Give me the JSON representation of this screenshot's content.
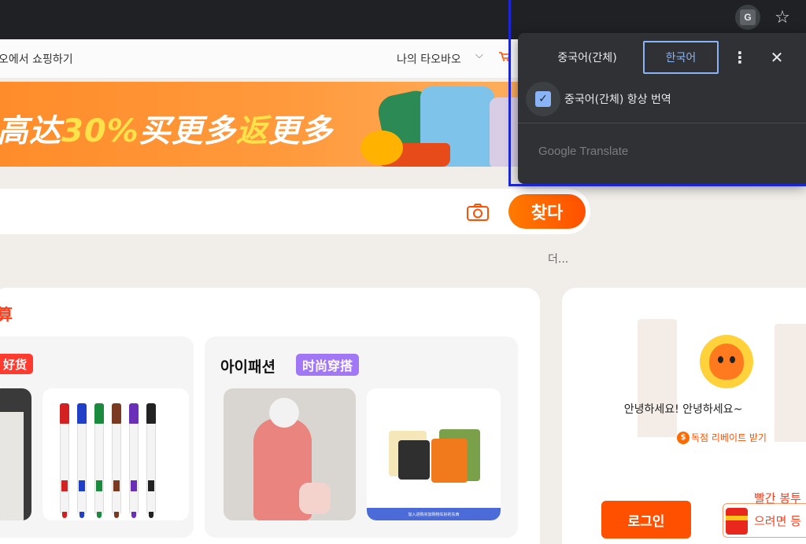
{
  "browser": {
    "translate_icon_text": "G",
    "star_icon_glyph": "☆"
  },
  "nav": {
    "title": "오에서 쇼핑하기",
    "my_taobao": "나의 타오바오",
    "chevron": "⌵"
  },
  "banner": {
    "text_prefix": "高达",
    "text_highlight1": "30%",
    "text_mid": "买更多",
    "text_highlight2": "返",
    "text_suffix": "更多"
  },
  "search": {
    "button_label": "찾다",
    "more_link": "더..."
  },
  "main": {
    "card_title": "算",
    "subcards": [
      {
        "tag": "好货"
      },
      {
        "title": "아이패션",
        "tag": "时尚穿搭"
      }
    ],
    "bag_strip_text": "加入进购买加购物车好的东西"
  },
  "right_panel": {
    "greeting": "안녕하세요! 안녕하세요~",
    "coin_symbol": "$",
    "rebate_label": "독점 리베이트 받기",
    "login_button": "로그인",
    "redpack_line1": "빨간 봉투",
    "redpack_line2": "으려면 등"
  },
  "translate_popup": {
    "source_lang": "중국어(간체)",
    "target_lang": "한국어",
    "menu_glyph": "⋮",
    "close_glyph": "✕",
    "always_translate_label": "중국어(간체) 항상 번역",
    "always_translate_checked": true,
    "check_glyph": "✓",
    "footer": "Google Translate"
  },
  "colors": {
    "accent": "#ff5000",
    "popup_bg": "#303134",
    "popup_accent": "#8ab4f8",
    "selection_outline": "#1a26d6"
  }
}
